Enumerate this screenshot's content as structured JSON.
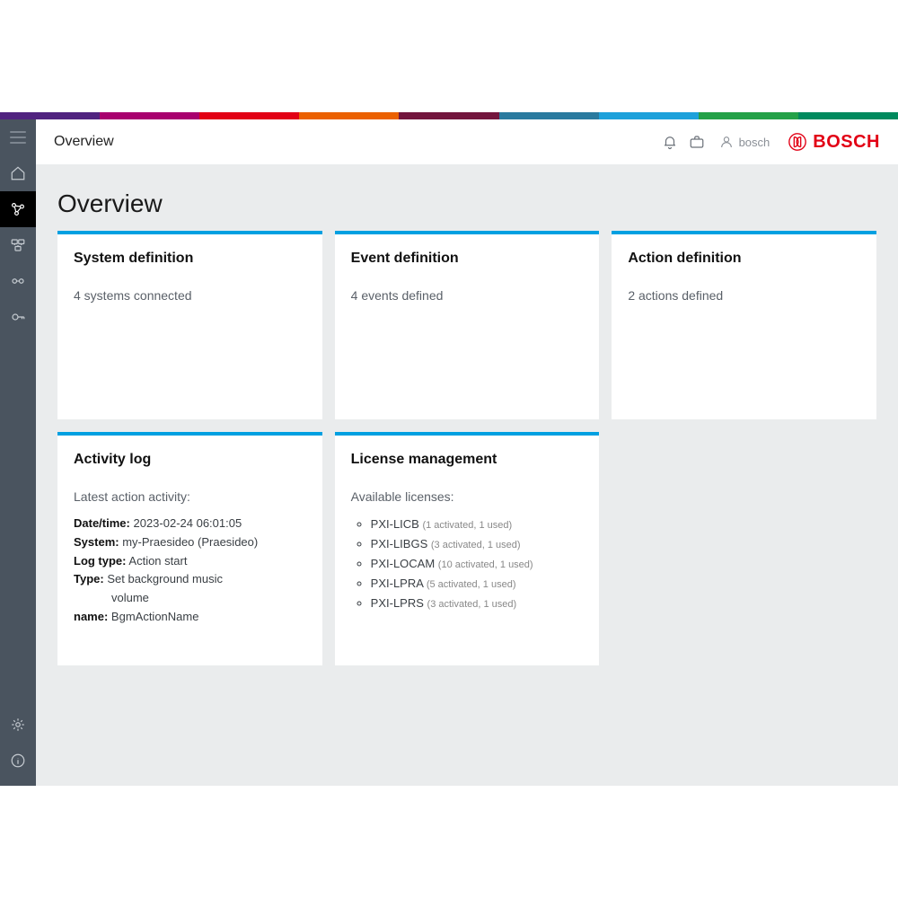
{
  "header": {
    "title": "Overview",
    "username": "bosch",
    "brand": "BOSCH"
  },
  "colorbar": [
    "#50237f",
    "#a8006e",
    "#e20015",
    "#eb6100",
    "#73163d",
    "#2a7a9f",
    "#1da1db",
    "#24a148",
    "#008a5e"
  ],
  "page": {
    "heading": "Overview"
  },
  "cards": {
    "sysdef": {
      "title": "System definition",
      "summary": "4 systems connected"
    },
    "evtdef": {
      "title": "Event definition",
      "summary": "4 events defined"
    },
    "actdef": {
      "title": "Action definition",
      "summary": "2 actions defined"
    },
    "activity": {
      "title": "Activity log",
      "lead": "Latest action activity:",
      "labels": {
        "datetime": "Date/time:",
        "system": "System:",
        "logtype": "Log type:",
        "type": "Type:",
        "name": "name:"
      },
      "values": {
        "datetime": "2023-02-24 06:01:05",
        "system": "my-Praesideo (Praesideo)",
        "logtype": "Action start",
        "type_line1": "Set background music",
        "type_line2": "volume",
        "name": "BgmActionName"
      }
    },
    "license": {
      "title": "License management",
      "lead": "Available licenses:",
      "items": [
        {
          "code": "PXI-LICB",
          "note": "(1 activated, 1 used)"
        },
        {
          "code": "PXI-LIBGS",
          "note": "(3 activated, 1 used)"
        },
        {
          "code": "PXI-LOCAM",
          "note": "(10 activated, 1 used)"
        },
        {
          "code": "PXI-LPRA",
          "note": "(5 activated, 1 used)"
        },
        {
          "code": "PXI-LPRS",
          "note": "(3 activated, 1 used)"
        }
      ]
    }
  }
}
